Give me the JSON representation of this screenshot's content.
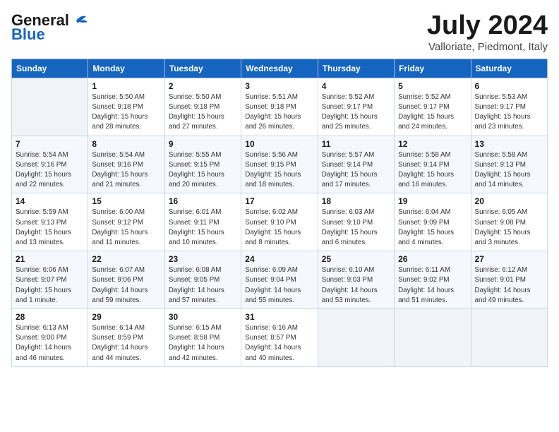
{
  "header": {
    "logo_general": "General",
    "logo_blue": "Blue",
    "month": "July 2024",
    "location": "Valloriate, Piedmont, Italy"
  },
  "days_of_week": [
    "Sunday",
    "Monday",
    "Tuesday",
    "Wednesday",
    "Thursday",
    "Friday",
    "Saturday"
  ],
  "weeks": [
    [
      {
        "day": "",
        "info": ""
      },
      {
        "day": "1",
        "info": "Sunrise: 5:50 AM\nSunset: 9:18 PM\nDaylight: 15 hours\nand 28 minutes."
      },
      {
        "day": "2",
        "info": "Sunrise: 5:50 AM\nSunset: 9:18 PM\nDaylight: 15 hours\nand 27 minutes."
      },
      {
        "day": "3",
        "info": "Sunrise: 5:51 AM\nSunset: 9:18 PM\nDaylight: 15 hours\nand 26 minutes."
      },
      {
        "day": "4",
        "info": "Sunrise: 5:52 AM\nSunset: 9:17 PM\nDaylight: 15 hours\nand 25 minutes."
      },
      {
        "day": "5",
        "info": "Sunrise: 5:52 AM\nSunset: 9:17 PM\nDaylight: 15 hours\nand 24 minutes."
      },
      {
        "day": "6",
        "info": "Sunrise: 5:53 AM\nSunset: 9:17 PM\nDaylight: 15 hours\nand 23 minutes."
      }
    ],
    [
      {
        "day": "7",
        "info": "Sunrise: 5:54 AM\nSunset: 9:16 PM\nDaylight: 15 hours\nand 22 minutes."
      },
      {
        "day": "8",
        "info": "Sunrise: 5:54 AM\nSunset: 9:16 PM\nDaylight: 15 hours\nand 21 minutes."
      },
      {
        "day": "9",
        "info": "Sunrise: 5:55 AM\nSunset: 9:15 PM\nDaylight: 15 hours\nand 20 minutes."
      },
      {
        "day": "10",
        "info": "Sunrise: 5:56 AM\nSunset: 9:15 PM\nDaylight: 15 hours\nand 18 minutes."
      },
      {
        "day": "11",
        "info": "Sunrise: 5:57 AM\nSunset: 9:14 PM\nDaylight: 15 hours\nand 17 minutes."
      },
      {
        "day": "12",
        "info": "Sunrise: 5:58 AM\nSunset: 9:14 PM\nDaylight: 15 hours\nand 16 minutes."
      },
      {
        "day": "13",
        "info": "Sunrise: 5:58 AM\nSunset: 9:13 PM\nDaylight: 15 hours\nand 14 minutes."
      }
    ],
    [
      {
        "day": "14",
        "info": "Sunrise: 5:59 AM\nSunset: 9:13 PM\nDaylight: 15 hours\nand 13 minutes."
      },
      {
        "day": "15",
        "info": "Sunrise: 6:00 AM\nSunset: 9:12 PM\nDaylight: 15 hours\nand 11 minutes."
      },
      {
        "day": "16",
        "info": "Sunrise: 6:01 AM\nSunset: 9:11 PM\nDaylight: 15 hours\nand 10 minutes."
      },
      {
        "day": "17",
        "info": "Sunrise: 6:02 AM\nSunset: 9:10 PM\nDaylight: 15 hours\nand 8 minutes."
      },
      {
        "day": "18",
        "info": "Sunrise: 6:03 AM\nSunset: 9:10 PM\nDaylight: 15 hours\nand 6 minutes."
      },
      {
        "day": "19",
        "info": "Sunrise: 6:04 AM\nSunset: 9:09 PM\nDaylight: 15 hours\nand 4 minutes."
      },
      {
        "day": "20",
        "info": "Sunrise: 6:05 AM\nSunset: 9:08 PM\nDaylight: 15 hours\nand 3 minutes."
      }
    ],
    [
      {
        "day": "21",
        "info": "Sunrise: 6:06 AM\nSunset: 9:07 PM\nDaylight: 15 hours\nand 1 minute."
      },
      {
        "day": "22",
        "info": "Sunrise: 6:07 AM\nSunset: 9:06 PM\nDaylight: 14 hours\nand 59 minutes."
      },
      {
        "day": "23",
        "info": "Sunrise: 6:08 AM\nSunset: 9:05 PM\nDaylight: 14 hours\nand 57 minutes."
      },
      {
        "day": "24",
        "info": "Sunrise: 6:09 AM\nSunset: 9:04 PM\nDaylight: 14 hours\nand 55 minutes."
      },
      {
        "day": "25",
        "info": "Sunrise: 6:10 AM\nSunset: 9:03 PM\nDaylight: 14 hours\nand 53 minutes."
      },
      {
        "day": "26",
        "info": "Sunrise: 6:11 AM\nSunset: 9:02 PM\nDaylight: 14 hours\nand 51 minutes."
      },
      {
        "day": "27",
        "info": "Sunrise: 6:12 AM\nSunset: 9:01 PM\nDaylight: 14 hours\nand 49 minutes."
      }
    ],
    [
      {
        "day": "28",
        "info": "Sunrise: 6:13 AM\nSunset: 9:00 PM\nDaylight: 14 hours\nand 46 minutes."
      },
      {
        "day": "29",
        "info": "Sunrise: 6:14 AM\nSunset: 8:59 PM\nDaylight: 14 hours\nand 44 minutes."
      },
      {
        "day": "30",
        "info": "Sunrise: 6:15 AM\nSunset: 8:58 PM\nDaylight: 14 hours\nand 42 minutes."
      },
      {
        "day": "31",
        "info": "Sunrise: 6:16 AM\nSunset: 8:57 PM\nDaylight: 14 hours\nand 40 minutes."
      },
      {
        "day": "",
        "info": ""
      },
      {
        "day": "",
        "info": ""
      },
      {
        "day": "",
        "info": ""
      }
    ]
  ]
}
